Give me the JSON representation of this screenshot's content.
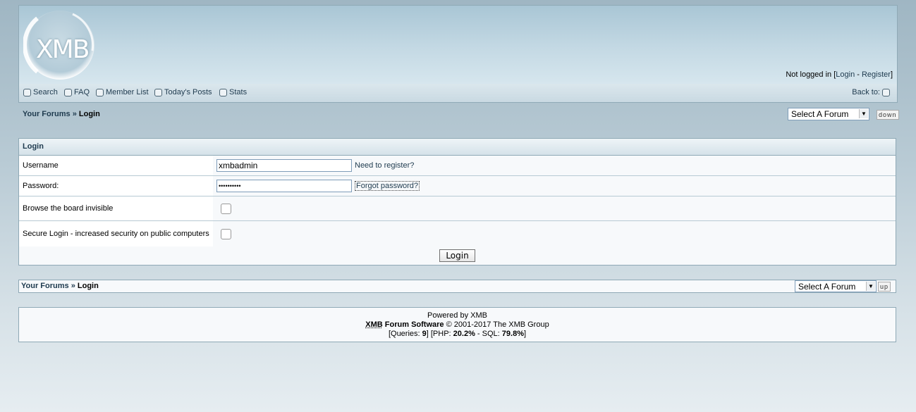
{
  "header": {
    "logo_text": "XMB",
    "status_prefix": "Not logged in [",
    "login_link": "Login",
    "separator": " - ",
    "register_link": "Register",
    "status_suffix": "]"
  },
  "navbar": {
    "items": [
      {
        "label": "Search",
        "icon": "search-icon"
      },
      {
        "label": "FAQ",
        "icon": "faq-icon"
      },
      {
        "label": "Member List",
        "icon": "member-list-icon"
      },
      {
        "label": "Today's Posts",
        "icon": "todays-posts-icon"
      },
      {
        "label": "Stats",
        "icon": "stats-icon"
      }
    ],
    "back_to": "Back to:"
  },
  "breadcrumb": {
    "home": "Your Forums",
    "sep": " » ",
    "current": "Login"
  },
  "forum_select": {
    "value": "Select A Forum",
    "jump_down": "down",
    "jump_up": "up"
  },
  "login_panel": {
    "title": "Login",
    "username_label": "Username",
    "username_value": "xmbadmin",
    "need_register": "Need to register?",
    "password_label": "Password:",
    "password_value": "••••••••••",
    "forgot_password": "Forgot password?",
    "invisible_label": "Browse the board invisible",
    "secure_label": "Secure Login - increased security on public computers",
    "submit": "Login"
  },
  "footer": {
    "powered": "Powered by XMB",
    "xmb": "XMB",
    "software": " Forum Software",
    "copyright": " © 2001-2017 The XMB Group",
    "q_prefix": "[Queries: ",
    "queries": "9",
    "php_prefix": "] [PHP: ",
    "php": "20.2%",
    "sql_prefix": " - SQL: ",
    "sql": "79.8%",
    "suffix": "]"
  }
}
